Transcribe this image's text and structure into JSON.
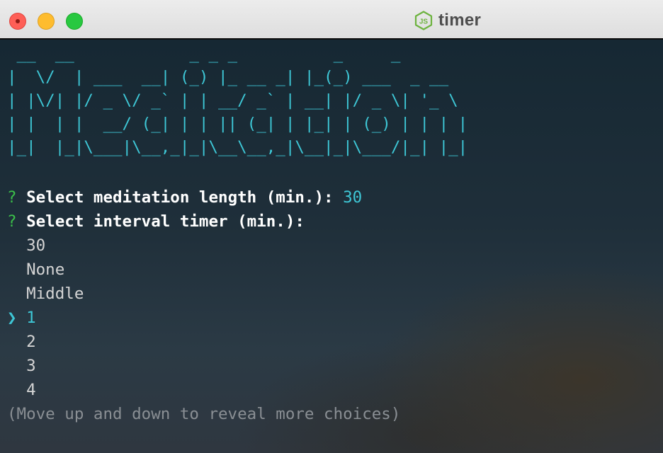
{
  "window": {
    "title": "timer",
    "title_icon": "nodejs-icon"
  },
  "terminal": {
    "banner_lines": [
      " __  __            _ _ _          _     _",
      "|  \\/  | ___  __| (_) |_ __ _| |_(_) ___  _ __",
      "| |\\/| |/ _ \\/ _` | | __/ _` | __| |/ _ \\| '_ \\",
      "| |  | |  __/ (_| | | || (_| | |_| | (_) | | | |",
      "|_|  |_|\\___|\\__,_|_|\\__\\__,_|\\__|_|\\___/|_| |_|"
    ],
    "question1": {
      "marker": "?",
      "text": "Select meditation length (min.):",
      "answer": "30"
    },
    "question2": {
      "marker": "?",
      "text": "Select interval timer (min.):"
    },
    "pointer": "❯",
    "choices": [
      "30",
      "None",
      "Middle",
      "1",
      "2",
      "3",
      "4"
    ],
    "selected_index": 3,
    "hint": "(Move up and down to reveal more choices)"
  },
  "colors": {
    "accent_cyan": "#3ec7d6",
    "question_green": "#3bbf4a",
    "hint_gray": "#8a8f94"
  }
}
